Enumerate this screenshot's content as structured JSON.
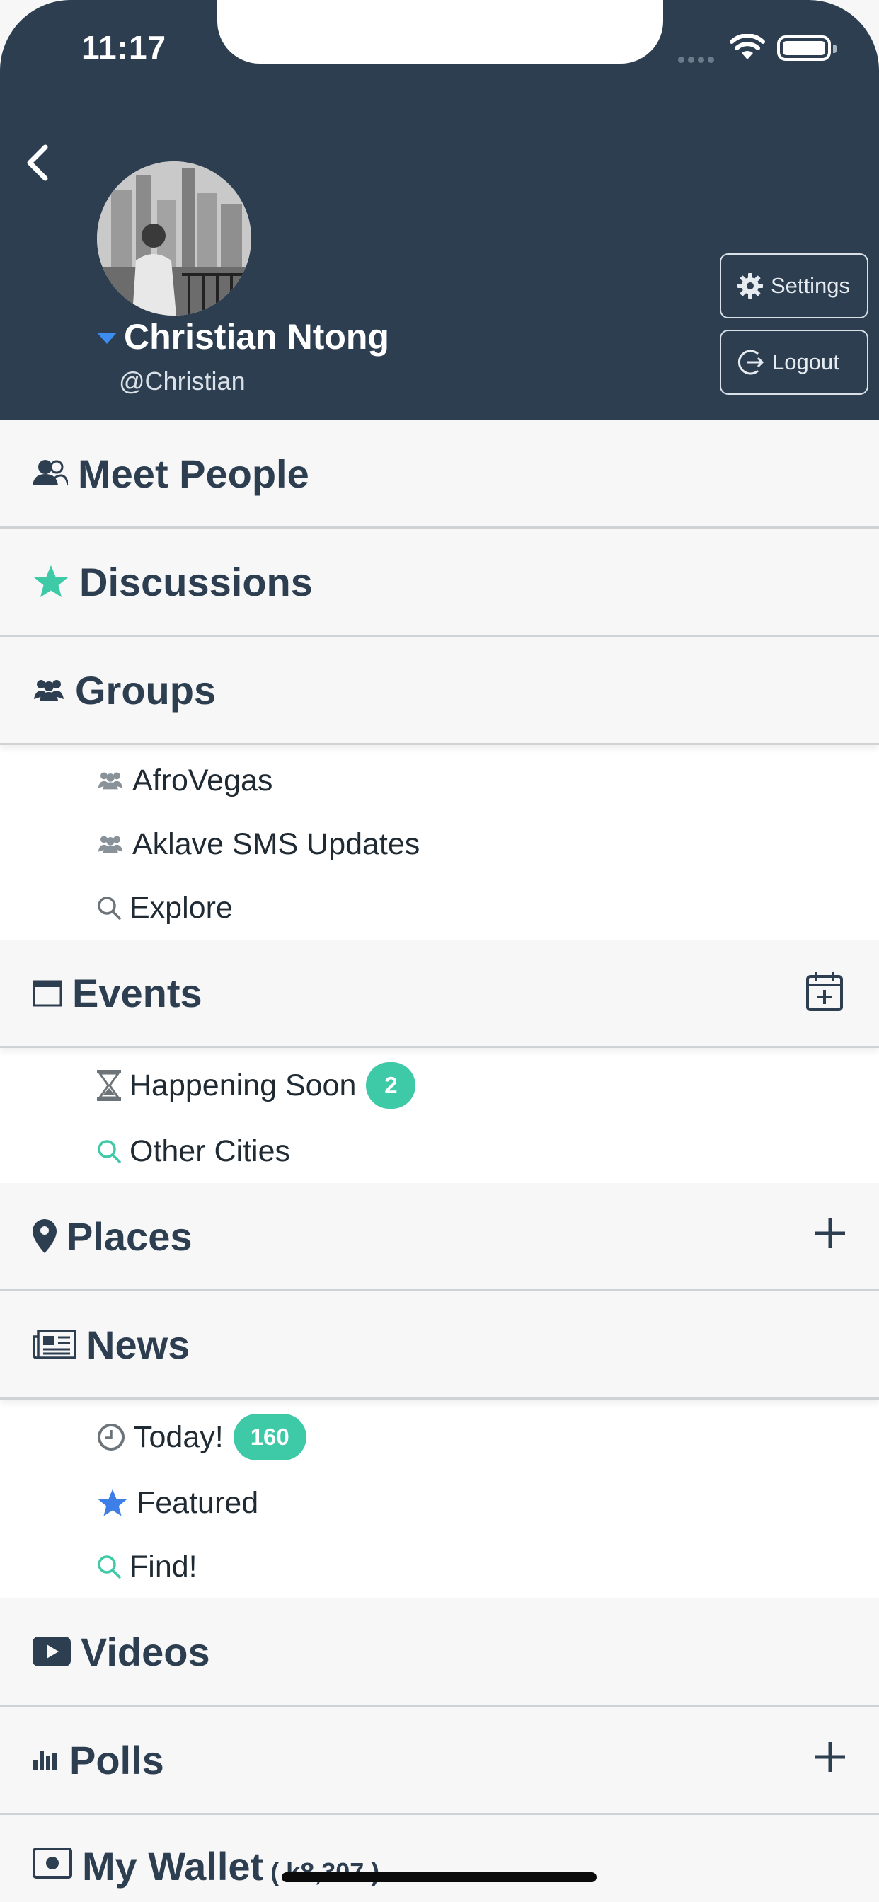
{
  "status_bar": {
    "time": "11:17"
  },
  "profile": {
    "name": "Christian Ntong",
    "handle": "@Christian"
  },
  "header_buttons": {
    "settings_label": "Settings",
    "logout_label": "Logout"
  },
  "menu": {
    "meet_people": "Meet People",
    "discussions": "Discussions",
    "groups": "Groups",
    "group_items": [
      {
        "label": "AfroVegas"
      },
      {
        "label": "Aklave SMS Updates"
      },
      {
        "label": "Explore"
      }
    ],
    "events": "Events",
    "event_items": [
      {
        "label": "Happening Soon",
        "badge": "2"
      },
      {
        "label": "Other Cities"
      }
    ],
    "places": "Places",
    "news": "News",
    "news_items": [
      {
        "label": "Today!",
        "badge": "160"
      },
      {
        "label": "Featured"
      },
      {
        "label": "Find!"
      }
    ],
    "videos": "Videos",
    "polls": "Polls",
    "wallet": "My Wallet",
    "wallet_balance": "( k8,307 )"
  },
  "colors": {
    "header_bg": "#2d3e50",
    "accent_green": "#3ec9a7",
    "accent_blue": "#3d8cf0",
    "section_bg": "#f7f7f7",
    "text_dark": "#2c3e50"
  }
}
